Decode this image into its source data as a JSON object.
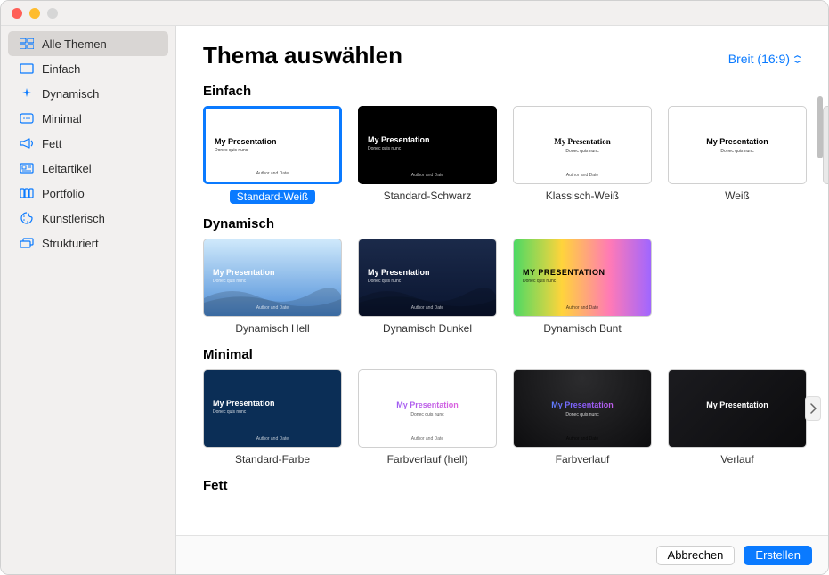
{
  "sidebar": {
    "items": [
      {
        "label": "Alle Themen",
        "icon": "grid-icon",
        "selected": true
      },
      {
        "label": "Einfach",
        "icon": "rectangle-icon",
        "selected": false
      },
      {
        "label": "Dynamisch",
        "icon": "sparkle-icon",
        "selected": false
      },
      {
        "label": "Minimal",
        "icon": "dots-icon",
        "selected": false
      },
      {
        "label": "Fett",
        "icon": "megaphone-icon",
        "selected": false
      },
      {
        "label": "Leitartikel",
        "icon": "article-icon",
        "selected": false
      },
      {
        "label": "Portfolio",
        "icon": "columns-icon",
        "selected": false
      },
      {
        "label": "Künstlerisch",
        "icon": "palette-icon",
        "selected": false
      },
      {
        "label": "Strukturiert",
        "icon": "layers-icon",
        "selected": false
      }
    ]
  },
  "header": {
    "title": "Thema auswählen",
    "aspect_label": "Breit (16:9)"
  },
  "placeholder": {
    "title": "My Presentation",
    "title_upper": "MY PRESENTATION",
    "subtitle": "Donec quis nunc",
    "author": "Author and Date"
  },
  "sections": [
    {
      "title": "Einfach",
      "themes": [
        {
          "name": "Standard-Weiß",
          "style": "white",
          "layout": "left",
          "selected": true
        },
        {
          "name": "Standard-Schwarz",
          "style": "dark",
          "layout": "left",
          "selected": false
        },
        {
          "name": "Klassisch-Weiß",
          "style": "white klassisch",
          "layout": "center",
          "selected": false
        },
        {
          "name": "Weiß",
          "style": "white",
          "layout": "center-light",
          "selected": false
        }
      ],
      "has_more_right": true,
      "scrollbar": true
    },
    {
      "title": "Dynamisch",
      "themes": [
        {
          "name": "Dynamisch Hell",
          "style": "dyn-light",
          "layout": "left-wave",
          "selected": false
        },
        {
          "name": "Dynamisch Dunkel",
          "style": "dyn-dark",
          "layout": "left-wave",
          "selected": false
        },
        {
          "name": "Dynamisch Bunt",
          "style": "dyn-bunt",
          "layout": "left-upper",
          "selected": false
        }
      ]
    },
    {
      "title": "Minimal",
      "themes": [
        {
          "name": "Standard-Farbe",
          "style": "stdfarbe",
          "layout": "left",
          "selected": false
        },
        {
          "name": "Farbverlauf (hell)",
          "style": "fv-hell",
          "layout": "center-gradient",
          "selected": false
        },
        {
          "name": "Farbverlauf",
          "style": "fv",
          "layout": "center-gradient",
          "selected": false
        },
        {
          "name": "Verlauf",
          "style": "verlauf",
          "layout": "center-simple",
          "selected": false
        }
      ],
      "has_arrow": true
    },
    {
      "title": "Fett",
      "themes": []
    }
  ],
  "footer": {
    "cancel": "Abbrechen",
    "create": "Erstellen"
  }
}
